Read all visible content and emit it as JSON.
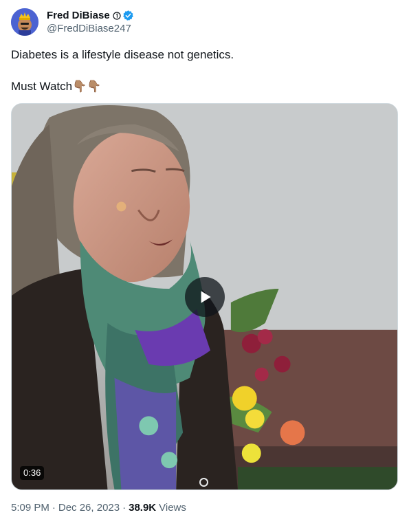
{
  "author": {
    "display_name": "Fred DiBiase",
    "handle": "@FredDiBiase247",
    "avatar_icon": "avatar-crowned-cartoon-icon",
    "affiliate_badge": "affiliate-circle-icon",
    "verified_badge": "verified-checkmark-icon",
    "verified_color": "#1d9bf0"
  },
  "tweet": {
    "line1": "Diabetes is a lifestyle disease not genetics.",
    "line2": "Must Watch",
    "emojis": "👇🏽👇🏽"
  },
  "media": {
    "duration": "0:36",
    "play_icon": "play-icon"
  },
  "meta": {
    "time": "5:09 PM",
    "separator": "·",
    "date": "Dec 26, 2023",
    "views_count": "38.9K",
    "views_label": "Views"
  },
  "colors": {
    "text_primary": "#0f1419",
    "text_secondary": "#536471",
    "border": "#cfd9de"
  }
}
